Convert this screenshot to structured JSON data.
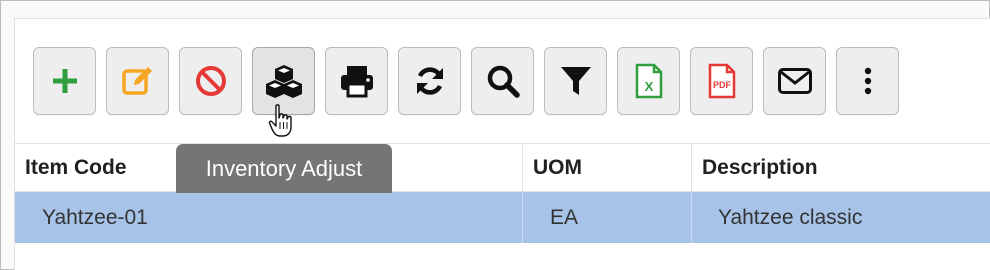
{
  "toolbar": {
    "buttons": [
      {
        "name": "add-button",
        "icon": "plus-icon",
        "color": "#2e9e3e"
      },
      {
        "name": "edit-button",
        "icon": "edit-icon",
        "color": "#f5a623"
      },
      {
        "name": "delete-button",
        "icon": "ban-icon",
        "color": "#e53935"
      },
      {
        "name": "inventory-adjust-button",
        "icon": "cubes-icon",
        "color": "#111111"
      },
      {
        "name": "print-button",
        "icon": "print-icon",
        "color": "#111111"
      },
      {
        "name": "refresh-button",
        "icon": "refresh-icon",
        "color": "#111111"
      },
      {
        "name": "search-button",
        "icon": "search-icon",
        "color": "#111111"
      },
      {
        "name": "filter-button",
        "icon": "filter-icon",
        "color": "#111111"
      },
      {
        "name": "export-excel-button",
        "icon": "excel-file-icon",
        "color": "#2e9e3e"
      },
      {
        "name": "export-pdf-button",
        "icon": "pdf-file-icon",
        "color": "#e53935"
      },
      {
        "name": "email-button",
        "icon": "envelope-icon",
        "color": "#111111"
      },
      {
        "name": "more-button",
        "icon": "more-vertical-icon",
        "color": "#111111"
      }
    ],
    "excel_badge": "X",
    "pdf_badge": "PDF"
  },
  "tooltip": {
    "text": "Inventory Adjust"
  },
  "grid": {
    "columns": [
      "Item Code",
      "UOM",
      "Description"
    ],
    "rows": [
      {
        "item_code": "Yahtzee-01",
        "uom": "EA",
        "description": "Yahtzee classic"
      }
    ],
    "selected_row_color": "#a7c4e8"
  }
}
